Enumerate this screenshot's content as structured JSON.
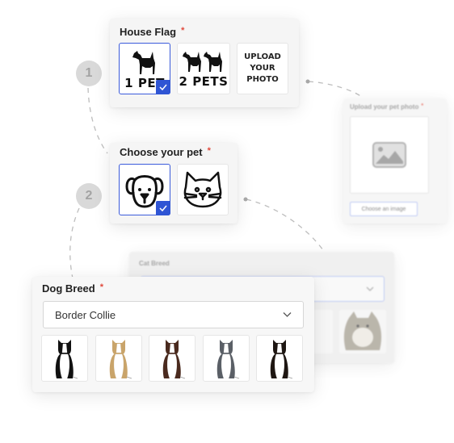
{
  "steps": [
    {
      "number": "1"
    },
    {
      "number": "2"
    }
  ],
  "house_flag": {
    "label": "House Flag",
    "required_marker": "*",
    "options": [
      {
        "label": "1 PET",
        "selected": true
      },
      {
        "label": "2 PETS",
        "selected": false
      },
      {
        "line1": "UPLOAD",
        "line2": "YOUR",
        "line3": "PHOTO",
        "selected": false
      }
    ]
  },
  "upload_photo": {
    "label": "Upload your pet photo",
    "required_marker": "*",
    "button_label": "Choose an image"
  },
  "choose_pet": {
    "label": "Choose your pet",
    "required_marker": "*",
    "options": [
      {
        "name": "dog",
        "selected": true
      },
      {
        "name": "cat",
        "selected": false
      }
    ]
  },
  "cat_breed": {
    "label": "Cat Breed"
  },
  "dog_breed": {
    "label": "Dog Breed",
    "required_marker": "*",
    "selected_value": "Border Collie",
    "variants": [
      {
        "name": "black-white",
        "colors": {
          "dark": "#111111",
          "light": "#ffffff"
        }
      },
      {
        "name": "tan-white",
        "colors": {
          "dark": "#c9a46a",
          "light": "#ffffff"
        }
      },
      {
        "name": "brown-white",
        "colors": {
          "dark": "#4a2a1e",
          "light": "#ffffff"
        }
      },
      {
        "name": "blue-merle",
        "colors": {
          "dark": "#5a5f66",
          "light": "#ffffff"
        }
      },
      {
        "name": "tricolor",
        "colors": {
          "dark": "#1e1612",
          "light": "#ffffff"
        }
      }
    ]
  },
  "colors": {
    "accent": "#2f55d4",
    "required": "#e0483b",
    "step_circle": "#d9d9d9"
  }
}
